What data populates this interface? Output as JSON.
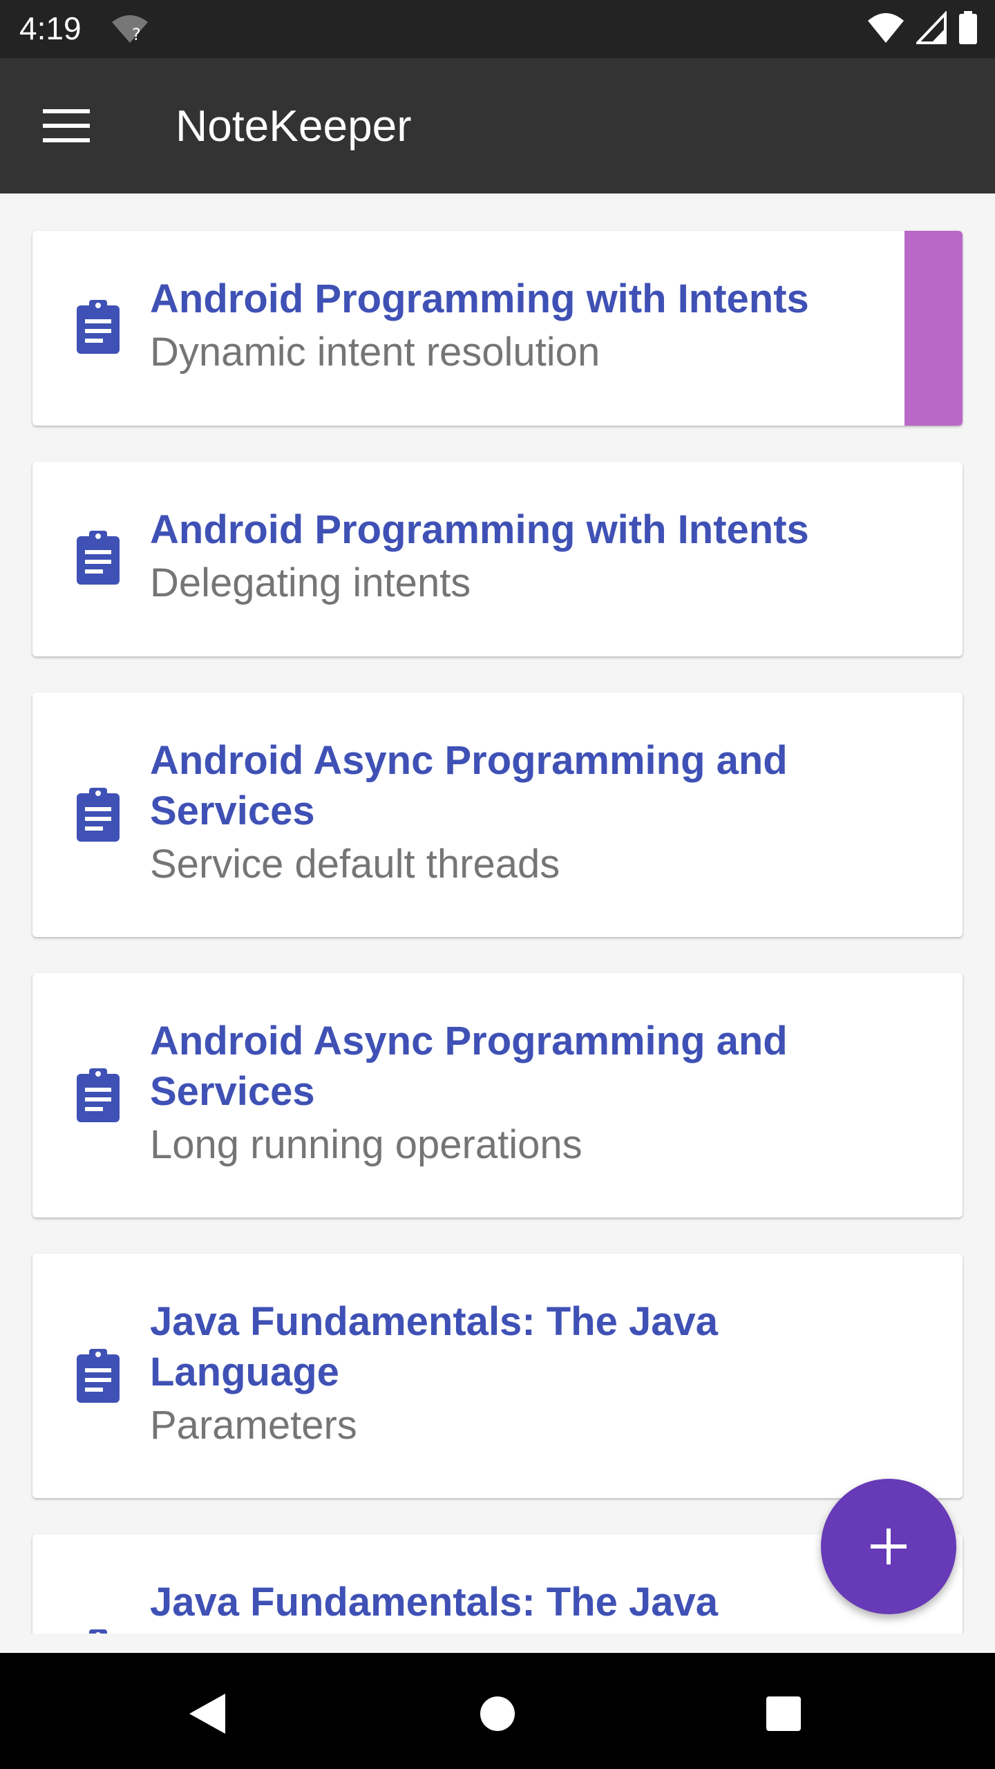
{
  "status_bar": {
    "time": "4:19"
  },
  "app_bar": {
    "title": "NoteKeeper"
  },
  "notes": [
    {
      "course": "Android Programming with Intents",
      "title": "Dynamic intent resolution"
    },
    {
      "course": "Android Programming with Intents",
      "title": "Delegating intents"
    },
    {
      "course": "Android Async Programming and Services",
      "title": "Service default threads"
    },
    {
      "course": "Android Async Programming and Services",
      "title": "Long running operations"
    },
    {
      "course": "Java Fundamentals: The Java Language",
      "title": "Parameters"
    },
    {
      "course": "Java Fundamentals: The Java",
      "title": ""
    }
  ],
  "icons": {
    "menu": "menu-icon",
    "note": "clipboard-icon",
    "fab": "plus-icon",
    "back": "back-triangle-icon",
    "home": "home-circle-icon",
    "recents": "recents-square-icon"
  },
  "colors": {
    "accent_purple": "#673ab7",
    "title_blue": "#3f51b5",
    "highlight": "#ba68c8",
    "app_bar": "#333333"
  }
}
